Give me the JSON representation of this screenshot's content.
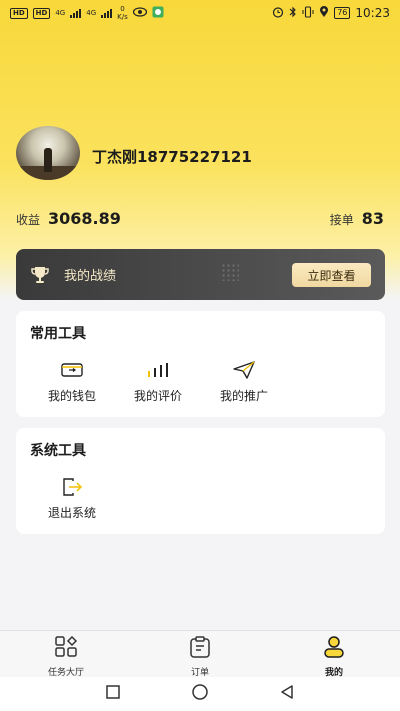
{
  "status_bar": {
    "hd1": "HD",
    "hd2": "HD",
    "net1": "4G",
    "net2": "4G",
    "speed_value": "0",
    "speed_unit": "K/s",
    "battery": "76",
    "time": "10:23"
  },
  "profile": {
    "name": "丁杰刚18775227121",
    "income_label": "收益",
    "income_value": "3068.89",
    "orders_label": "接单",
    "orders_value": "83"
  },
  "banner": {
    "title": "我的战绩",
    "button": "立即查看"
  },
  "common_tools": {
    "title": "常用工具",
    "items": [
      {
        "label": "我的钱包",
        "icon": "wallet-icon"
      },
      {
        "label": "我的评价",
        "icon": "bar-chart-icon"
      },
      {
        "label": "我的推广",
        "icon": "paper-plane-icon"
      }
    ]
  },
  "system_tools": {
    "title": "系统工具",
    "items": [
      {
        "label": "退出系统",
        "icon": "logout-icon"
      }
    ]
  },
  "bottom_nav": {
    "items": [
      {
        "label": "任务大厅",
        "icon": "grid-icon",
        "active": false
      },
      {
        "label": "订单",
        "icon": "clipboard-icon",
        "active": false
      },
      {
        "label": "我的",
        "icon": "user-icon",
        "active": true
      }
    ]
  },
  "colors": {
    "accent_yellow": "#f8d83a",
    "banner_dark": "#444444",
    "button_gold": "#f0d8a0"
  }
}
